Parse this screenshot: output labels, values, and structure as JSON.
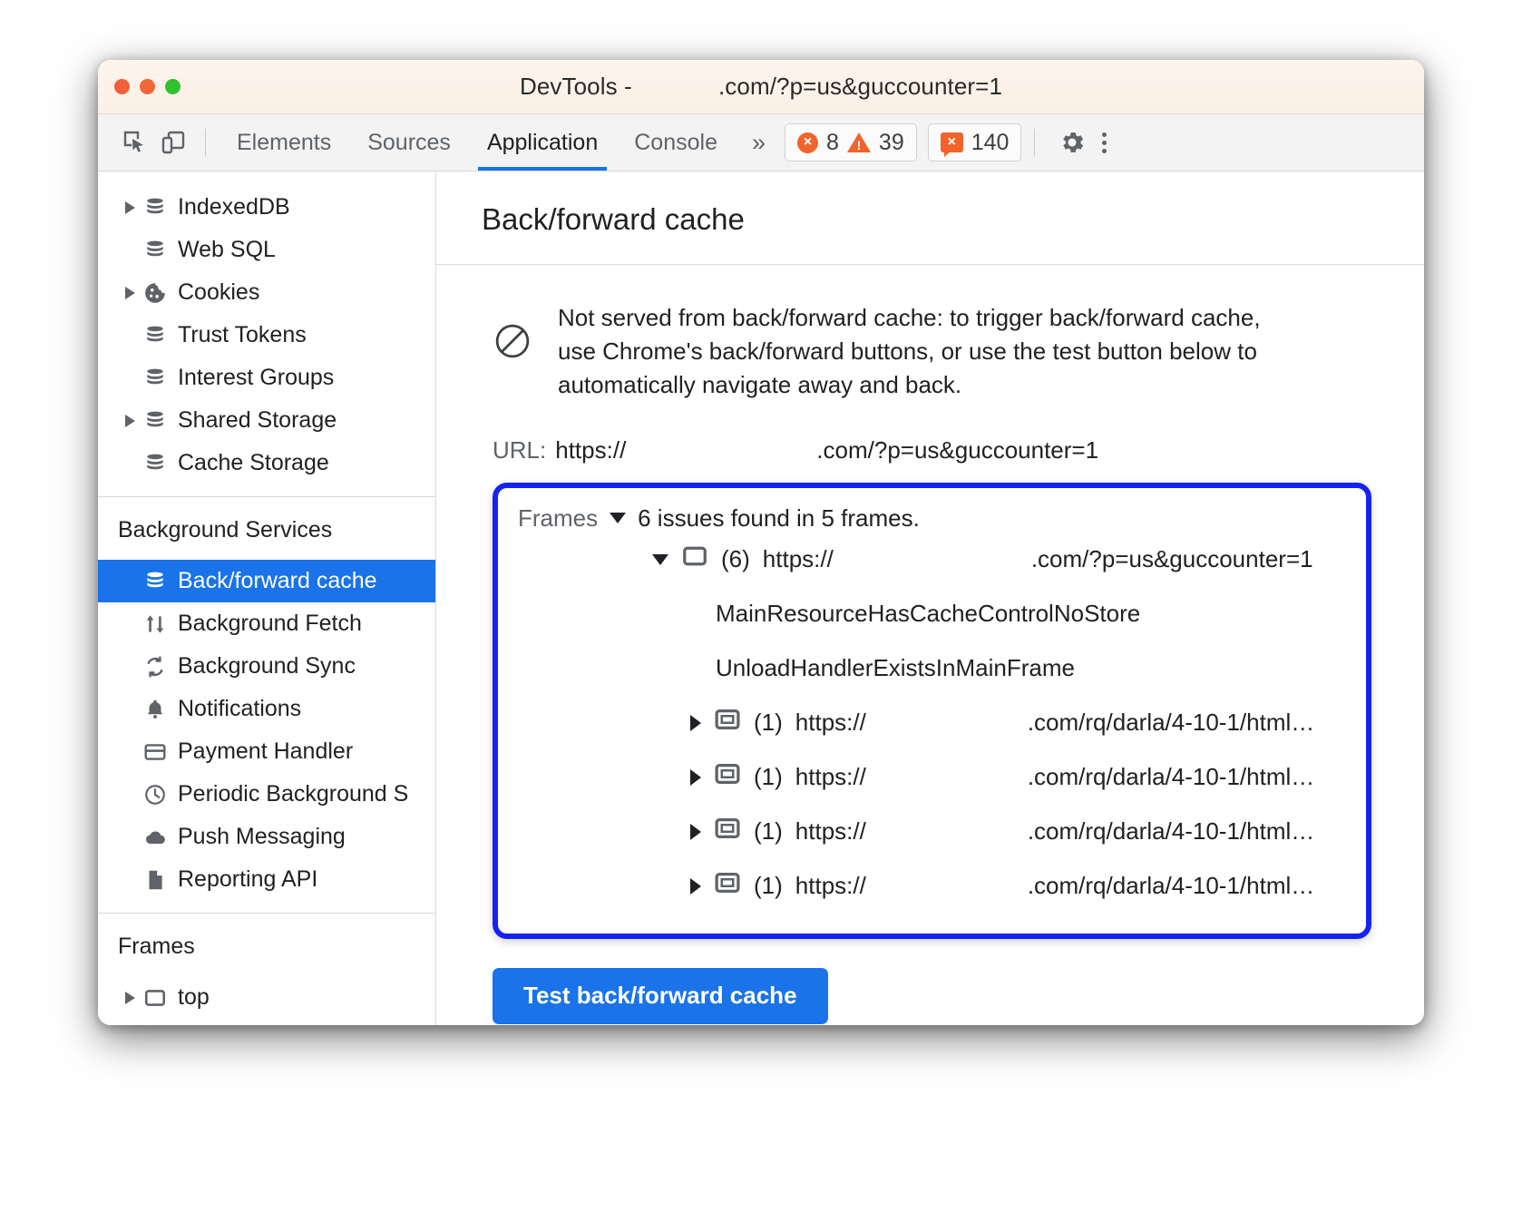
{
  "window": {
    "title": "DevTools -             .com/?p=us&guccounter=1",
    "traffic_lights": [
      "close",
      "minimize",
      "zoom"
    ]
  },
  "toolbar": {
    "inspect_icon": "inspect-cursor-icon",
    "device_icon": "device-toolbar-icon",
    "tabs": [
      {
        "label": "Elements",
        "active": false
      },
      {
        "label": "Sources",
        "active": false
      },
      {
        "label": "Application",
        "active": true
      },
      {
        "label": "Console",
        "active": false
      }
    ],
    "more_tabs": "»",
    "counters": {
      "errors": "8",
      "warnings": "39",
      "issues": "140",
      "error_glyph": "×",
      "warning_glyph": "!",
      "issue_glyph": "×"
    },
    "settings_icon": "gear-icon",
    "menu_icon": "kebab-menu-icon",
    "accent_color": "#1a73e8",
    "counter_color": "#f0642b"
  },
  "sidebar": {
    "storage_items": [
      {
        "label": "IndexedDB",
        "icon": "database-icon",
        "expandable": true
      },
      {
        "label": "Web SQL",
        "icon": "database-icon",
        "expandable": false
      },
      {
        "label": "Cookies",
        "icon": "cookie-icon",
        "expandable": true
      },
      {
        "label": "Trust Tokens",
        "icon": "database-icon",
        "expandable": false
      },
      {
        "label": "Interest Groups",
        "icon": "database-icon",
        "expandable": false
      },
      {
        "label": "Shared Storage",
        "icon": "database-icon",
        "expandable": true
      },
      {
        "label": "Cache Storage",
        "icon": "database-icon",
        "expandable": false
      }
    ],
    "background_services_title": "Background Services",
    "background_services_items": [
      {
        "label": "Back/forward cache",
        "icon": "database-icon",
        "selected": true
      },
      {
        "label": "Background Fetch",
        "icon": "updown-arrows-icon",
        "selected": false
      },
      {
        "label": "Background Sync",
        "icon": "sync-icon",
        "selected": false
      },
      {
        "label": "Notifications",
        "icon": "bell-icon",
        "selected": false
      },
      {
        "label": "Payment Handler",
        "icon": "credit-card-icon",
        "selected": false
      },
      {
        "label": "Periodic Background S",
        "icon": "clock-icon",
        "selected": false
      },
      {
        "label": "Push Messaging",
        "icon": "cloud-icon",
        "selected": false
      },
      {
        "label": "Reporting API",
        "icon": "document-icon",
        "selected": false
      }
    ],
    "frames_title": "Frames",
    "frames_items": [
      {
        "label": "top",
        "icon": "frame-icon",
        "expandable": true
      }
    ],
    "selected_bg": "#1a73e8"
  },
  "main": {
    "page_title": "Back/forward cache",
    "status_icon": "blocked-circle-icon",
    "status_message": "Not served from back/forward cache: to trigger back/forward cache, use Chrome's back/forward buttons, or use the test button below to automatically navigate away and back.",
    "url_label": "URL:",
    "url_prefix": "https://",
    "url_suffix": ".com/?p=us&guccounter=1",
    "frames_section": {
      "label": "Frames",
      "summary": "6 issues found in 5 frames.",
      "highlight_color": "#1722f0",
      "tree": [
        {
          "expanded": true,
          "icon": "frame-icon",
          "count": "(6)",
          "url_prefix": "https://",
          "url_suffix": ".com/?p=us&guccounter=1",
          "reasons": [
            "MainResourceHasCacheControlNoStore",
            "UnloadHandlerExistsInMainFrame"
          ]
        },
        {
          "expanded": false,
          "icon": "iframe-icon",
          "count": "(1)",
          "url_prefix": "https://",
          "url_suffix": ".com/rq/darla/4-10-1/html…",
          "reasons": []
        },
        {
          "expanded": false,
          "icon": "iframe-icon",
          "count": "(1)",
          "url_prefix": "https://",
          "url_suffix": ".com/rq/darla/4-10-1/html…",
          "reasons": []
        },
        {
          "expanded": false,
          "icon": "iframe-icon",
          "count": "(1)",
          "url_prefix": "https://",
          "url_suffix": ".com/rq/darla/4-10-1/html…",
          "reasons": []
        },
        {
          "expanded": false,
          "icon": "iframe-icon",
          "count": "(1)",
          "url_prefix": "https://",
          "url_suffix": ".com/rq/darla/4-10-1/html…",
          "reasons": []
        }
      ]
    },
    "test_button_label": "Test back/forward cache"
  }
}
